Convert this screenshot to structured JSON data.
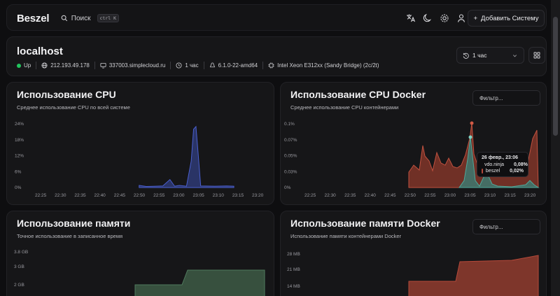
{
  "navbar": {
    "logo": "Beszel",
    "search_label": "Поиск",
    "search_kbd_ctrl": "ctrl",
    "search_kbd_key": "K",
    "add_system_label": "Добавить Систему"
  },
  "system": {
    "name": "localhost",
    "status": "Up",
    "status_color": "#22c55e",
    "ip": "212.193.49.178",
    "host": "337003.simplecloud.ru",
    "uptime": "1 час",
    "kernel": "6.1.0-22-amd64",
    "cpu": "Intel Xeon E312xx (Sandy Bridge) (2c/2t)",
    "range_label": "1 час"
  },
  "charts": {
    "cpu": {
      "title": "Использование CPU",
      "description": "Среднее использование CPU по всей системе"
    },
    "cpu_docker": {
      "title": "Использование CPU Docker",
      "description": "Среднее использование CPU контейнерами",
      "filter_placeholder": "Фильтр...",
      "tooltip": {
        "title": "26 февр., 23:06",
        "rows": [
          {
            "name": "vdo.ninja",
            "value": "0,08%",
            "color": "#4fa89a"
          },
          {
            "name": "beszel",
            "value": "0,02%",
            "color": "#b5493a"
          }
        ]
      }
    },
    "memory": {
      "title": "Использование памяти",
      "description": "Точное использование в записанное время"
    },
    "memory_docker": {
      "title": "Использование памяти Docker",
      "description": "Использование памяти контейнерами Docker",
      "filter_placeholder": "Фильтр..."
    }
  },
  "chart_data": [
    {
      "type": "area",
      "title": "Использование CPU",
      "x": [
        "22:25",
        "22:30",
        "22:35",
        "22:40",
        "22:45",
        "22:50",
        "22:55",
        "23:00",
        "23:05",
        "23:10",
        "23:15",
        "23:20"
      ],
      "ylim": [
        0,
        24
      ],
      "yticks": [
        "0%",
        "6%",
        "12%",
        "18%",
        "24%"
      ],
      "color": "#3d4fa8",
      "series": [
        {
          "points": [
            [
              22.83,
              0.8
            ],
            [
              22.86,
              0.4
            ],
            [
              22.9,
              0.5
            ],
            [
              22.93,
              0.6
            ],
            [
              22.96,
              3
            ],
            [
              22.98,
              0.5
            ],
            [
              23.0,
              0.8
            ],
            [
              23.03,
              0.5
            ],
            [
              23.05,
              10
            ],
            [
              23.06,
              22
            ],
            [
              23.07,
              23
            ],
            [
              23.08,
              12
            ],
            [
              23.09,
              0.6
            ],
            [
              23.15,
              0.5
            ],
            [
              23.2,
              0.6
            ],
            [
              23.23,
              0.5
            ]
          ]
        }
      ]
    },
    {
      "type": "area",
      "title": "Использование CPU Docker",
      "x": [
        "22:25",
        "22:30",
        "22:35",
        "22:40",
        "22:45",
        "22:50",
        "22:55",
        "23:00",
        "23:05",
        "23:10",
        "23:15",
        "23:20"
      ],
      "ylim": [
        0,
        0.1
      ],
      "yticks": [
        "0%",
        "0.03%",
        "0.05%",
        "0.07%",
        "0.1%"
      ],
      "series": [
        {
          "name": "beszel",
          "color": "#b5493a"
        },
        {
          "name": "vdo.ninja",
          "color": "#4fa89a"
        }
      ]
    },
    {
      "type": "area",
      "title": "Использование памяти",
      "x": [
        "22:25",
        "22:30",
        "22:35",
        "22:40",
        "22:45",
        "22:50",
        "22:55",
        "23:00",
        "23:05",
        "23:10",
        "23:15",
        "23:20"
      ],
      "yticks": [
        "2 GB",
        "3 GB",
        "3.8 GB"
      ],
      "color": "#3d5a45"
    },
    {
      "type": "area",
      "title": "Использование памяти Docker",
      "x": [
        "22:25",
        "22:30",
        "22:35",
        "22:40",
        "22:45",
        "22:50",
        "22:55",
        "23:00",
        "23:05",
        "23:10",
        "23:15",
        "23:20"
      ],
      "yticks": [
        "14 MB",
        "21 MB",
        "28 MB"
      ],
      "color": "#8a3a2e"
    }
  ]
}
